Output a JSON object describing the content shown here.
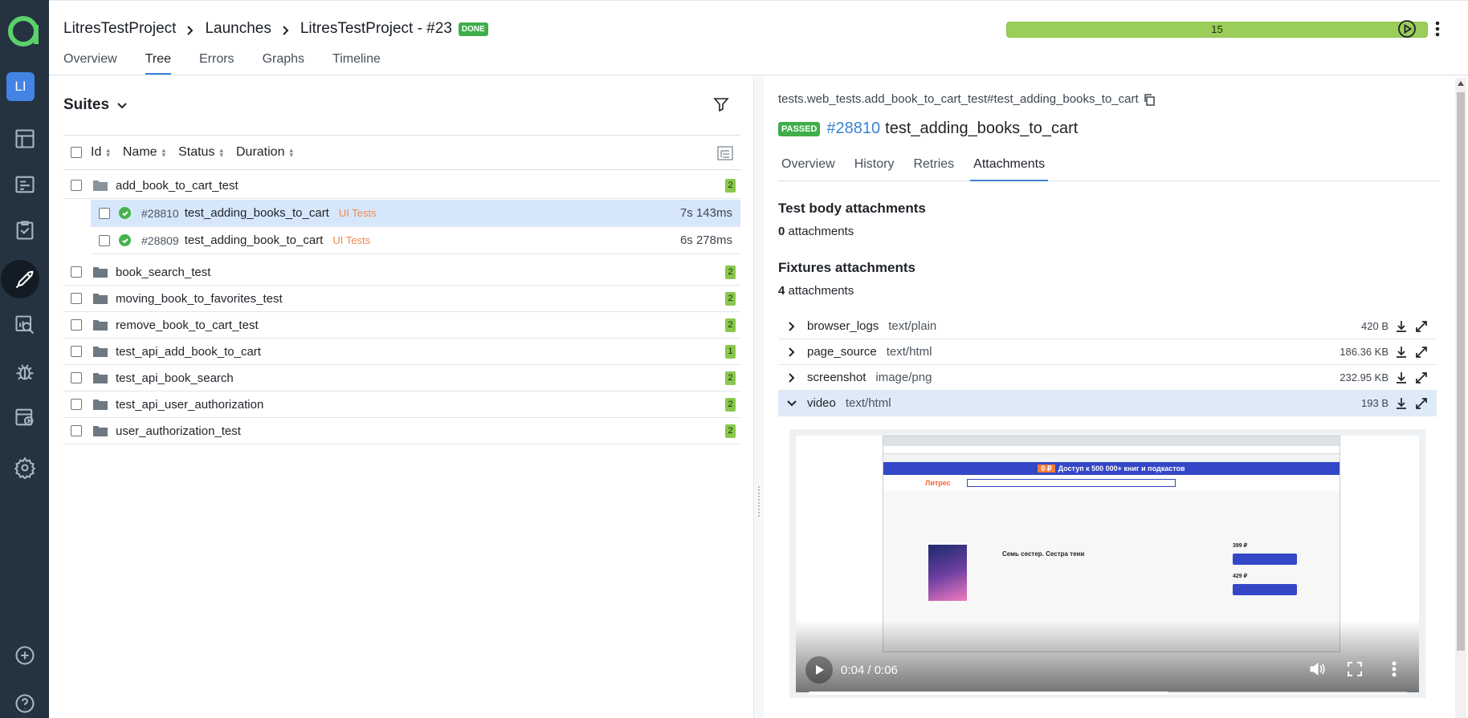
{
  "rail": {
    "project_initials": "LI",
    "nav_items": [
      "dashboards-icon",
      "launches-icon",
      "test-plans-icon",
      "jobs-icon",
      "analytics-icon",
      "defects-icon",
      "test-cases-icon",
      "settings-icon"
    ],
    "active": "launches-icon"
  },
  "header": {
    "breadcrumbs": [
      "LitresTestProject",
      "Launches",
      "LitresTestProject - #23"
    ],
    "status_badge": "DONE",
    "progress_label": "15",
    "tabs": [
      "Overview",
      "Tree",
      "Errors",
      "Graphs",
      "Timeline"
    ],
    "active_tab": "Tree"
  },
  "left": {
    "title": "Suites",
    "columns": [
      "Id",
      "Name",
      "Status",
      "Duration"
    ],
    "suites": [
      {
        "name": "add_book_to_cart_test",
        "count": "2",
        "expanded": true
      },
      {
        "name": "book_search_test",
        "count": "2"
      },
      {
        "name": "moving_book_to_favorites_test",
        "count": "2"
      },
      {
        "name": "remove_book_to_cart_test",
        "count": "2"
      },
      {
        "name": "test_api_add_book_to_cart",
        "count": "1"
      },
      {
        "name": "test_api_book_search",
        "count": "2"
      },
      {
        "name": "test_api_user_authorization",
        "count": "2"
      },
      {
        "name": "user_authorization_test",
        "count": "2"
      }
    ],
    "tests": [
      {
        "id": "#28810",
        "name": "test_adding_books_to_cart",
        "tag": "UI Tests",
        "duration": "7s 143ms",
        "selected": true
      },
      {
        "id": "#28809",
        "name": "test_adding_book_to_cart",
        "tag": "UI Tests",
        "duration": "6s 278ms",
        "selected": false
      }
    ]
  },
  "right": {
    "full_name": "tests.web_tests.add_book_to_cart_test#test_adding_books_to_cart",
    "status": "PASSED",
    "test_id": "#28810",
    "test_name": "test_adding_books_to_cart",
    "tabs": [
      "Overview",
      "History",
      "Retries",
      "Attachments"
    ],
    "active_tab": "Attachments",
    "body_title": "Test body attachments",
    "body_count": "0",
    "body_count_label": "attachments",
    "fixtures_title": "Fixtures attachments",
    "fixtures_count": "4",
    "fixtures_count_label": "attachments",
    "attachments": [
      {
        "name": "browser_logs",
        "type": "text/plain",
        "size": "420 B"
      },
      {
        "name": "page_source",
        "type": "text/html",
        "size": "186.36 KB"
      },
      {
        "name": "screenshot",
        "type": "image/png",
        "size": "232.95 KB"
      },
      {
        "name": "video",
        "type": "text/html",
        "size": "193 B",
        "open": true
      }
    ],
    "video": {
      "time": "0:04 / 0:06",
      "progress": 0.6,
      "banner_text": "Доступ к 500 000+ книг и подкастов",
      "banner_badge": "0 ₽",
      "site_logo": "Литрес",
      "book_title": "Семь сестер. Сестра тени",
      "price_1": "399 ₽",
      "price_2": "429 ₽"
    }
  }
}
